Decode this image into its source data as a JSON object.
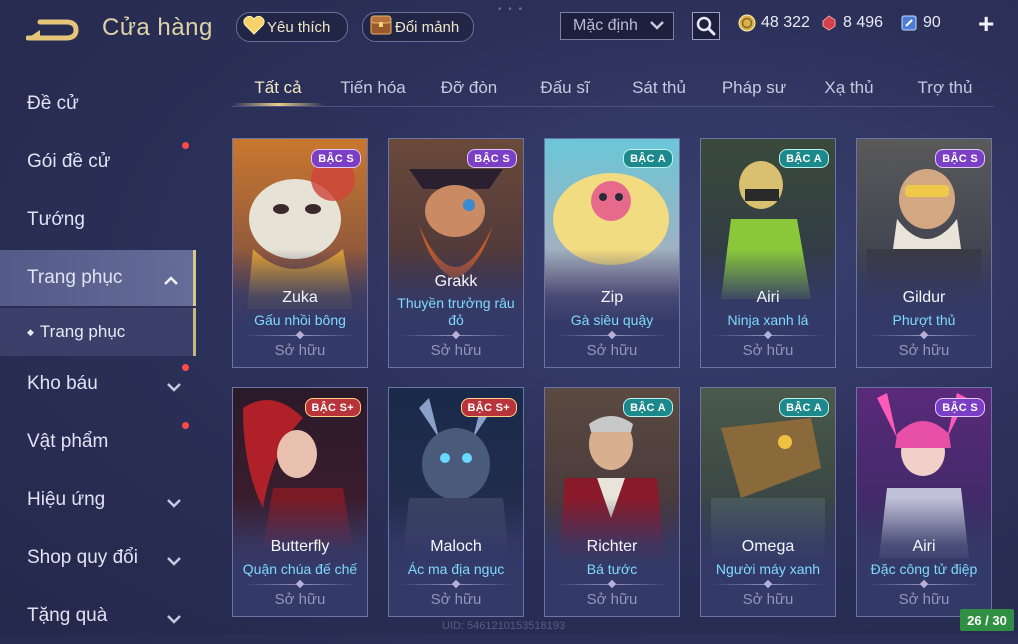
{
  "header": {
    "title": "Cửa hàng",
    "favorite_label": "Yêu thích",
    "shard_label": "Đổi mảnh",
    "sort_selected": "Mặc định",
    "currencies": {
      "gold": "48 322",
      "ruby": "8 496",
      "voucher": "90"
    },
    "plus_label": "+"
  },
  "sidebar": {
    "items": [
      {
        "label": "Đề cử"
      },
      {
        "label": "Gói đề cử"
      },
      {
        "label": "Tướng"
      },
      {
        "label": "Trang phục"
      },
      {
        "label": "Kho báu"
      },
      {
        "label": "Vật phẩm"
      },
      {
        "label": "Hiệu ứng"
      },
      {
        "label": "Shop quy đổi"
      },
      {
        "label": "Tặng quà"
      }
    ],
    "sub_item": "Trang phục"
  },
  "tabs": [
    "Tất cả",
    "Tiến hóa",
    "Đỡ đòn",
    "Đấu sĩ",
    "Sát thủ",
    "Pháp sư",
    "Xạ thủ",
    "Trợ thủ"
  ],
  "cards": [
    {
      "hero": "Zuka",
      "skin": "Gấu nhồi bông",
      "tier": "BẬC S",
      "status": "Sở hữu"
    },
    {
      "hero": "Grakk",
      "skin": "Thuyền trưởng râu đỏ",
      "tier": "BẬC S",
      "status": "Sở hữu"
    },
    {
      "hero": "Zip",
      "skin": "Gà siêu quậy",
      "tier": "BẬC A",
      "status": "Sở hữu"
    },
    {
      "hero": "Airi",
      "skin": "Ninja xanh lá",
      "tier": "BẬC A",
      "status": "Sở hữu"
    },
    {
      "hero": "Gildur",
      "skin": "Phượt thủ",
      "tier": "BẬC S",
      "status": "Sở hữu"
    },
    {
      "hero": "Butterfly",
      "skin": "Quận chúa đế chế",
      "tier": "BẬC S+",
      "status": "Sở hữu"
    },
    {
      "hero": "Maloch",
      "skin": "Ác ma địa ngục",
      "tier": "BẬC S+",
      "status": "Sở hữu"
    },
    {
      "hero": "Richter",
      "skin": "Bá tước",
      "tier": "BẬC A",
      "status": "Sở hữu"
    },
    {
      "hero": "Omega",
      "skin": "Người máy xanh",
      "tier": "BẬC A",
      "status": "Sở hữu"
    },
    {
      "hero": "Airi",
      "skin": "Đặc công tử điệp",
      "tier": "BẬC S",
      "status": "Sở hữu"
    }
  ],
  "footer": {
    "uid": "UID: 546121015351819​3",
    "page_counter": "26 / 30"
  },
  "colors": {
    "accent_gold": "#dfd3a8",
    "skin_name": "#7fd9ff",
    "notification_dot": "#ff4a4a",
    "page_counter_bg": "#2f8f43"
  }
}
